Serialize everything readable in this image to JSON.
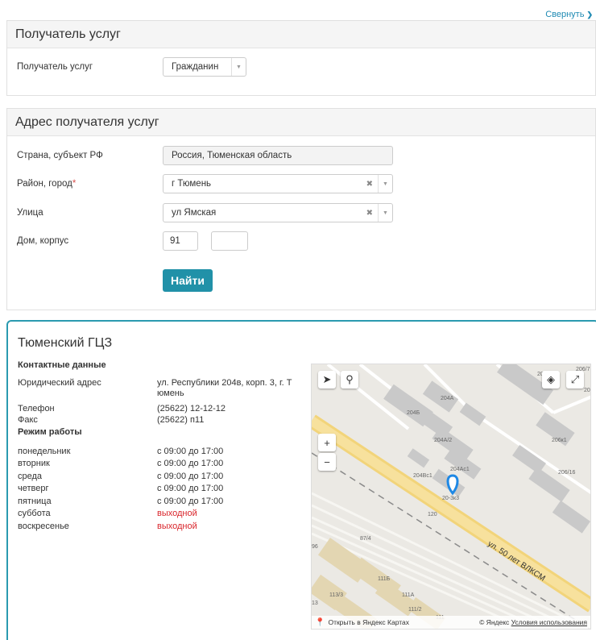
{
  "header": {
    "collapse_label": "Свернуть"
  },
  "recipient": {
    "title": "Получатель услуг",
    "field_label": "Получатель услуг",
    "value": "Гражданин"
  },
  "address": {
    "title": "Адрес получателя услуг",
    "country_label": "Страна, субъект РФ",
    "country_value": "Россия, Тюменская область",
    "city_label": "Район, город",
    "city_required": "*",
    "city_value": "г Тюмень",
    "street_label": "Улица",
    "street_value": "ул Ямская",
    "house_label": "Дом, корпус",
    "house_value": "91",
    "building_value": "",
    "find_button": "Найти"
  },
  "organization": {
    "name": "Тюменский ГЦЗ",
    "contacts_heading": "Контактные данные",
    "legal_address_label": "Юридический адрес",
    "legal_address_value": "ул. Республики 204в, корп. 3, г. Т юмень",
    "phone_label": "Телефон",
    "phone_value": "(25622) 12-12-12",
    "fax_label": "Факс",
    "fax_value": "(25622) п11",
    "schedule_heading": "Режим работы",
    "schedule": [
      {
        "day": "понедельник",
        "hours": "с 09:00 до 17:00",
        "status": "open"
      },
      {
        "day": "вторник",
        "hours": "с 09:00 до 17:00",
        "status": "open"
      },
      {
        "day": "среда",
        "hours": "с 09:00 до 17:00",
        "status": "open"
      },
      {
        "day": "четверг",
        "hours": "с 09:00 до 17:00",
        "status": "open"
      },
      {
        "day": "пятница",
        "hours": "с 09:00 до 17:00",
        "status": "open"
      },
      {
        "day": "суббота",
        "hours": "выходной",
        "status": "off"
      },
      {
        "day": "воскресенье",
        "hours": "выходной",
        "status": "off"
      }
    ]
  },
  "map": {
    "open_link": "Открыть в Яндекс Картах",
    "copyright": "© Яндекс",
    "terms": "Условия использования",
    "street_label": "ул. 50 лет ВЛКСМ",
    "building_labels": [
      "204А",
      "204Б",
      "204А/2",
      "204Ас1",
      "204Вс1",
      "206к1",
      "206/16",
      "20-3к3",
      "120",
      "87/4",
      "111Б",
      "113/3",
      "111А",
      "111/2",
      "111",
      "96",
      "13",
      "206/7",
      "20",
      "20"
    ],
    "controls": [
      "locate-icon",
      "search-icon",
      "layers-icon",
      "fullscreen-icon",
      "zoom-in-icon",
      "zoom-out-icon"
    ]
  }
}
